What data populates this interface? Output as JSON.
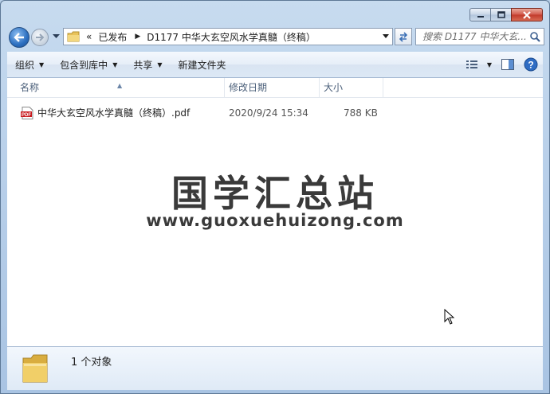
{
  "window": {
    "caption_buttons": [
      "minimize",
      "maximize",
      "close"
    ]
  },
  "navigation": {
    "breadcrumb_overflow": "«",
    "breadcrumbs": [
      "已发布",
      "D1177 中华大玄空风水学真髓（终稿）"
    ],
    "search_placeholder": "搜索 D1177 中华大玄..."
  },
  "toolbar": {
    "organize_label": "组织",
    "include_in_library_label": "包含到库中",
    "share_label": "共享",
    "new_folder_label": "新建文件夹"
  },
  "columns": {
    "name": "名称",
    "modified": "修改日期",
    "size": "大小"
  },
  "files": [
    {
      "name": "中华大玄空风水学真髓（终稿）.pdf",
      "modified": "2020/9/24 15:34",
      "size": "788 KB",
      "icon": "pdf-file-icon"
    }
  ],
  "watermark": {
    "title": "国学汇总站",
    "url": "www.guoxuehuizong.com"
  },
  "status": {
    "item_count": "1 个对象"
  },
  "colors": {
    "window_frame": "#b9d0ea",
    "toolbar": "#dce8f5",
    "column_header_text": "#4c607a",
    "pdf_red": "#c8191d"
  }
}
